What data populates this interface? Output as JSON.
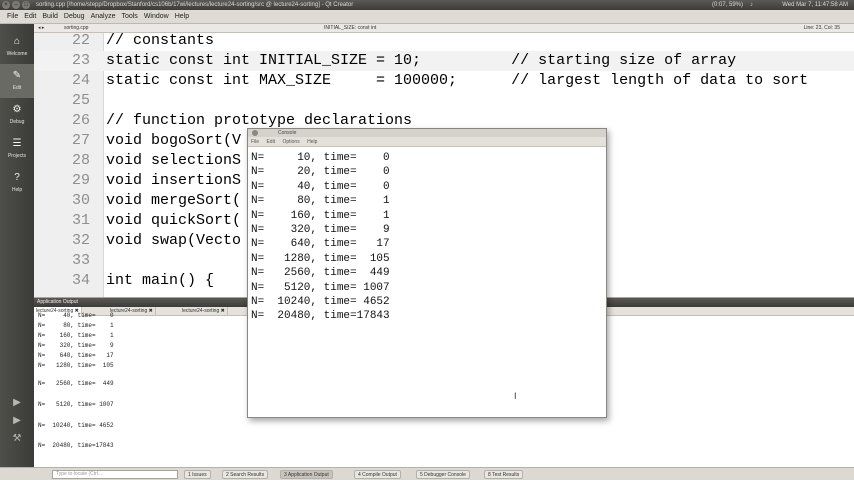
{
  "window": {
    "title": "sorting.cpp [/home/stepp/Dropbox/Stanford/cs106b/17wi/lectures/lecture24-sorting/src @ lecture24-sorting] - Qt Creator",
    "tray_battery": "(0:07, 59%)",
    "tray_volume": "♪",
    "tray_clock": "Wed Mar 7, 11:47:58 AM",
    "controls": [
      "×",
      "–",
      "□"
    ]
  },
  "menu": [
    "File",
    "Edit",
    "Build",
    "Debug",
    "Analyze",
    "Tools",
    "Window",
    "Help"
  ],
  "editor_header": {
    "arrows": "◂ ▸",
    "file": "sorting.cpp",
    "function": "INITIAL_SIZE: const int",
    "position": "Line: 23, Col: 35"
  },
  "modes": [
    {
      "label": "Welcome",
      "icon": "⌂"
    },
    {
      "label": "Edit",
      "icon": "✎"
    },
    {
      "label": "Debug",
      "icon": "⚙"
    },
    {
      "label": "Projects",
      "icon": "☰"
    },
    {
      "label": "Help",
      "icon": "?"
    }
  ],
  "run_buttons": [
    "▶",
    "▶",
    "⚒"
  ],
  "code_lines": [
    {
      "n": "22",
      "text": "// constants"
    },
    {
      "n": "23",
      "text": "static const int INITIAL_SIZE = 10;          // starting size of array"
    },
    {
      "n": "24",
      "text": "static const int MAX_SIZE     = 100000;      // largest length of data to sort"
    },
    {
      "n": "25",
      "text": ""
    },
    {
      "n": "26",
      "text": "// function prototype declarations"
    },
    {
      "n": "27",
      "text": "void bogoSort(V"
    },
    {
      "n": "28",
      "text": "void selectionS"
    },
    {
      "n": "29",
      "text": "void insertionS"
    },
    {
      "n": "30",
      "text": "void mergeSort("
    },
    {
      "n": "31",
      "text": "void quickSort("
    },
    {
      "n": "32",
      "text": "void swap(Vecto"
    },
    {
      "n": "33",
      "text": ""
    },
    {
      "n": "34",
      "text": "int main() {"
    }
  ],
  "output_pane": {
    "title": "Application Output",
    "tabs": [
      "lecture24-sorting ✖",
      "lecture24-sorting ✖",
      "lecture24-sorting ✖"
    ],
    "rows": [
      "N=     40, time=    0",
      "N=     80, time=    1",
      "N=    160, time=    1",
      "N=    320, time=    9",
      "N=    640, time=   17",
      "N=   1280, time=  105",
      "N=   2560, time=  449",
      "N=   5120, time= 1007",
      "N=  10240, time= 4652",
      "N=  20480, time=17843"
    ]
  },
  "console": {
    "title": "Console",
    "menu": [
      "File",
      "Edit",
      "Options",
      "Help"
    ],
    "rows": [
      "N=     10, time=    0",
      "N=     20, time=    0",
      "N=     40, time=    0",
      "N=     80, time=    1",
      "N=    160, time=    1",
      "N=    320, time=    9",
      "N=    640, time=   17",
      "N=   1280, time=  105",
      "N=   2560, time=  449",
      "N=   5120, time= 1007",
      "N=  10240, time= 4652",
      "N=  20480, time=17843"
    ],
    "cursor": "I"
  },
  "statusbar": {
    "locator_placeholder": "Type to locate (Ctrl...",
    "panes": [
      "1 Issues",
      "2 Search Results",
      "3 Application Output",
      "4 Compile Output",
      "5 Debugger Console",
      "8 Test Results"
    ]
  }
}
